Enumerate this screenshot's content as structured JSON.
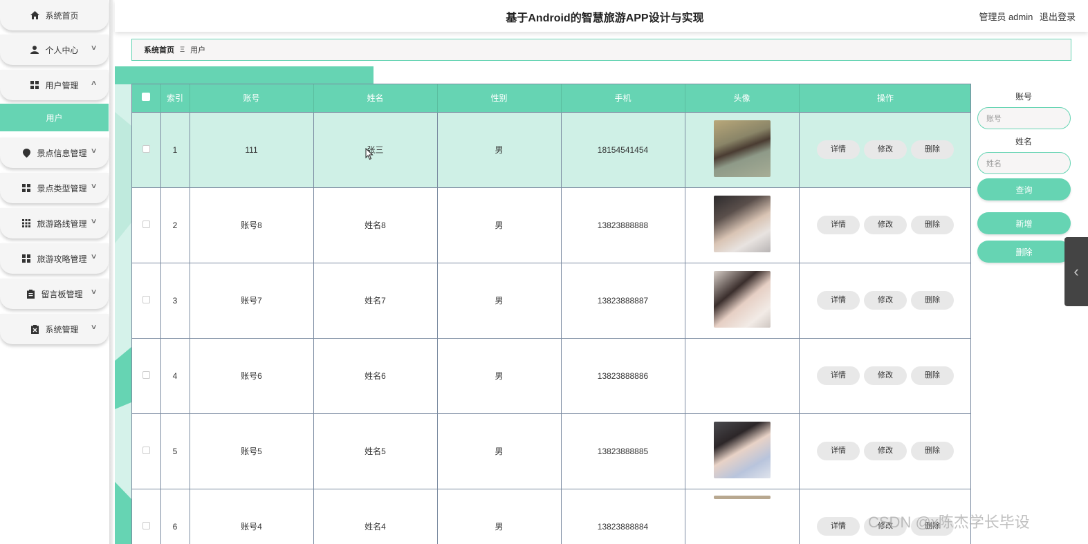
{
  "header": {
    "title": "基于Android的智慧旅游APP设计与实现",
    "user_role": "管理员 admin",
    "logout": "退出登录"
  },
  "sidebar": {
    "items": [
      {
        "label": "系统首页",
        "icon": "home-icon"
      },
      {
        "label": "个人中心",
        "icon": "person-icon"
      },
      {
        "label": "用户管理",
        "icon": "grid-icon"
      },
      {
        "label": "景点信息管理",
        "icon": "pin-icon"
      },
      {
        "label": "景点类型管理",
        "icon": "grid-icon"
      },
      {
        "label": "旅游路线管理",
        "icon": "apps-icon"
      },
      {
        "label": "旅游攻略管理",
        "icon": "grid-icon"
      },
      {
        "label": "留言板管理",
        "icon": "clipboard-icon"
      },
      {
        "label": "系统管理",
        "icon": "clipboard-x-icon"
      }
    ],
    "active_sub": "用户"
  },
  "breadcrumb": {
    "home": "系统首页",
    "sep": "Ξ",
    "current": "用户"
  },
  "table": {
    "headers": [
      "索引",
      "账号",
      "姓名",
      "性别",
      "手机",
      "头像",
      "操作"
    ],
    "actions": {
      "detail": "详情",
      "edit": "修改",
      "delete": "删除"
    },
    "rows": [
      {
        "index": "1",
        "account": "111",
        "name": "张三",
        "gender": "男",
        "phone": "18154541454",
        "avatar": true
      },
      {
        "index": "2",
        "account": "账号8",
        "name": "姓名8",
        "gender": "男",
        "phone": "13823888888",
        "avatar": true
      },
      {
        "index": "3",
        "account": "账号7",
        "name": "姓名7",
        "gender": "男",
        "phone": "13823888887",
        "avatar": true
      },
      {
        "index": "4",
        "account": "账号6",
        "name": "姓名6",
        "gender": "男",
        "phone": "13823888886",
        "avatar": false
      },
      {
        "index": "5",
        "account": "账号5",
        "name": "姓名5",
        "gender": "男",
        "phone": "13823888885",
        "avatar": true
      },
      {
        "index": "6",
        "account": "账号4",
        "name": "姓名4",
        "gender": "男",
        "phone": "13823888884",
        "avatar": true
      }
    ]
  },
  "search": {
    "account_label": "账号",
    "account_placeholder": "账号",
    "name_label": "姓名",
    "name_placeholder": "姓名",
    "query_btn": "查询",
    "add_btn": "新增",
    "delete_btn": "删除"
  },
  "watermark": "CSDN @x陈杰学长毕设",
  "colors": {
    "accent": "#66d4b3",
    "highlight_row": "#cff0e6"
  }
}
